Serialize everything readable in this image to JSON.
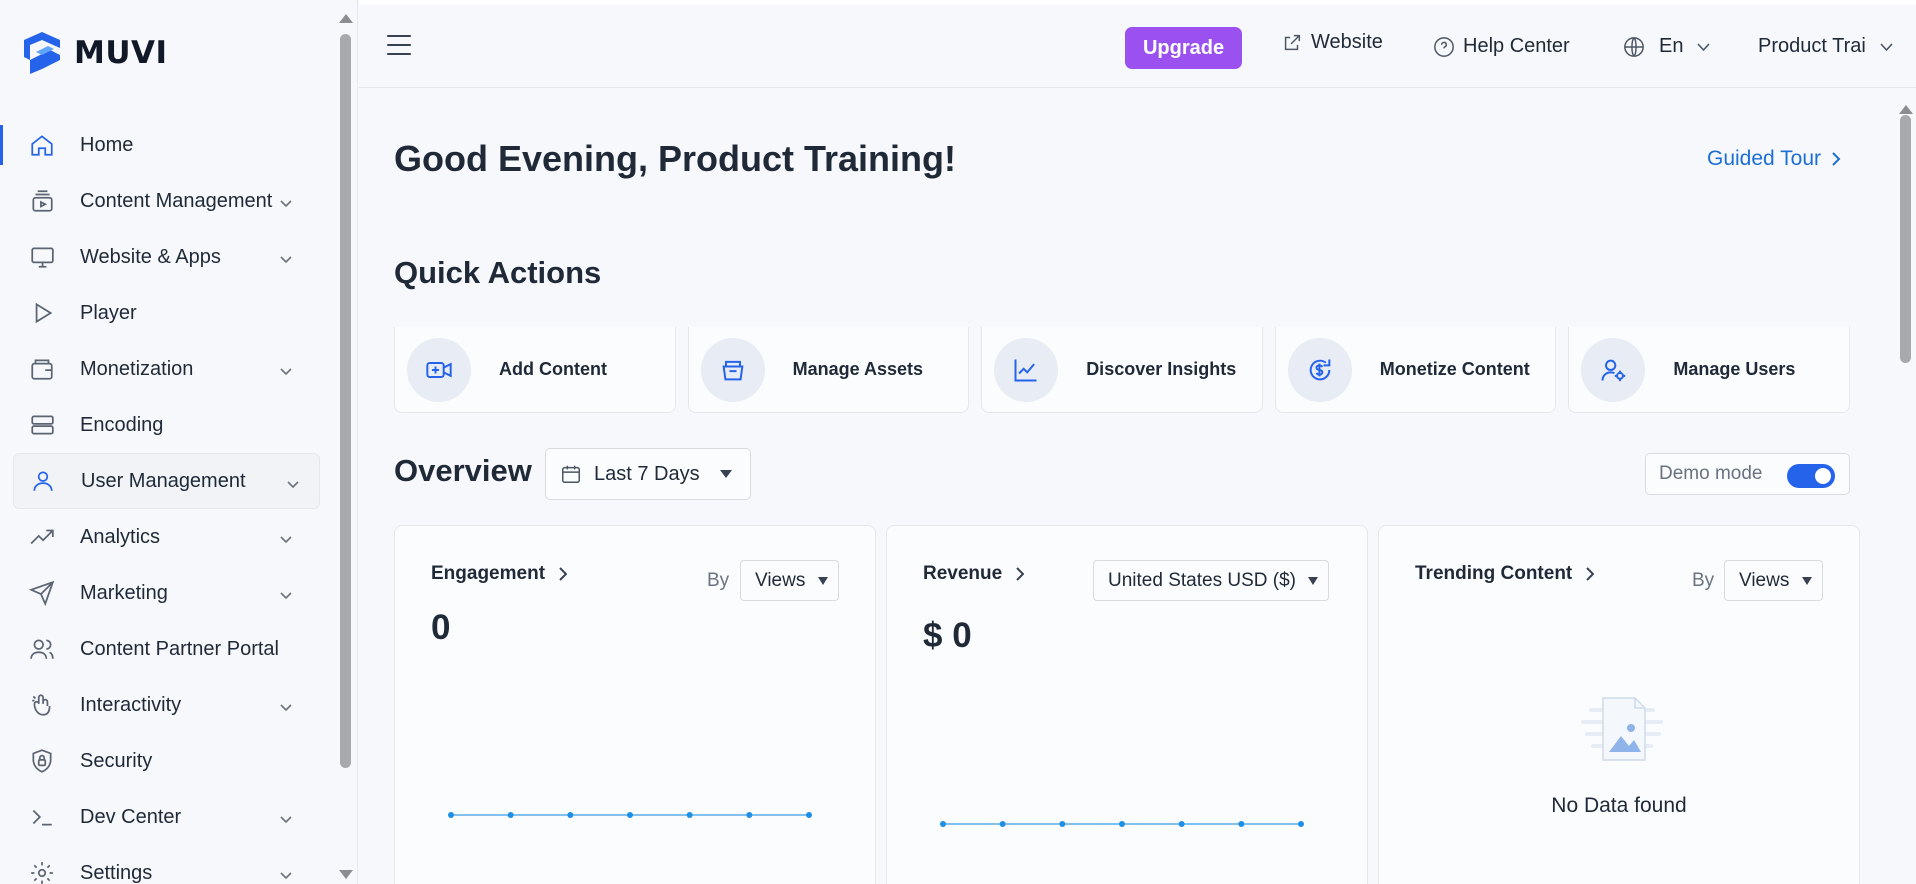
{
  "brand": {
    "name": "MUVI",
    "color": "#2563eb"
  },
  "sidebar": {
    "items": [
      {
        "label": "Home",
        "icon": "home-icon",
        "expandable": false,
        "active": true
      },
      {
        "label": "Content Management",
        "icon": "content-stack-icon",
        "expandable": true
      },
      {
        "label": "Website & Apps",
        "icon": "monitor-icon",
        "expandable": true
      },
      {
        "label": "Player",
        "icon": "play-icon",
        "expandable": false
      },
      {
        "label": "Monetization",
        "icon": "wallet-icon",
        "expandable": true
      },
      {
        "label": "Encoding",
        "icon": "server-icon",
        "expandable": false
      },
      {
        "label": "User Management",
        "icon": "user-icon",
        "expandable": true,
        "hovered": true
      },
      {
        "label": "Analytics",
        "icon": "trend-icon",
        "expandable": true
      },
      {
        "label": "Marketing",
        "icon": "send-icon",
        "expandable": true
      },
      {
        "label": "Content Partner Portal",
        "icon": "users-icon",
        "expandable": false
      },
      {
        "label": "Interactivity",
        "icon": "touch-icon",
        "expandable": true
      },
      {
        "label": "Security",
        "icon": "shield-icon",
        "expandable": false
      },
      {
        "label": "Dev Center",
        "icon": "terminal-icon",
        "expandable": true
      },
      {
        "label": "Settings",
        "icon": "gear-icon",
        "expandable": true
      }
    ]
  },
  "header": {
    "upgrade_label": "Upgrade",
    "upgrade_color": "#9b51f0",
    "website_label": "Website",
    "help_label": "Help Center",
    "language": "En",
    "account": "Product Trai"
  },
  "main": {
    "greeting": "Good Evening, Product Training!",
    "guided_tour": "Guided Tour",
    "quick_actions_title": "Quick Actions",
    "quick_actions": [
      {
        "label": "Add Content",
        "icon": "video-add-icon"
      },
      {
        "label": "Manage Assets",
        "icon": "assets-icon"
      },
      {
        "label": "Discover Insights",
        "icon": "chart-trend-icon"
      },
      {
        "label": "Monetize Content",
        "icon": "dollar-icon"
      },
      {
        "label": "Manage Users",
        "icon": "user-gear-icon"
      }
    ],
    "overview_title": "Overview",
    "date_range": "Last 7 Days",
    "demo_mode_label": "Demo mode",
    "demo_mode_on": true,
    "cards": {
      "engagement": {
        "title": "Engagement",
        "by": "By",
        "select": "Views",
        "value": "0"
      },
      "revenue": {
        "title": "Revenue",
        "select": "United States USD ($)",
        "value": "$ 0"
      },
      "trending": {
        "title": "Trending Content",
        "by": "By",
        "select": "Views",
        "empty": "No Data found"
      }
    }
  },
  "chart_data": [
    {
      "type": "line",
      "title": "Engagement",
      "values": [
        0,
        0,
        0,
        0,
        0,
        0,
        0
      ]
    },
    {
      "type": "line",
      "title": "Revenue",
      "values": [
        0,
        0,
        0,
        0,
        0,
        0,
        0
      ]
    }
  ]
}
